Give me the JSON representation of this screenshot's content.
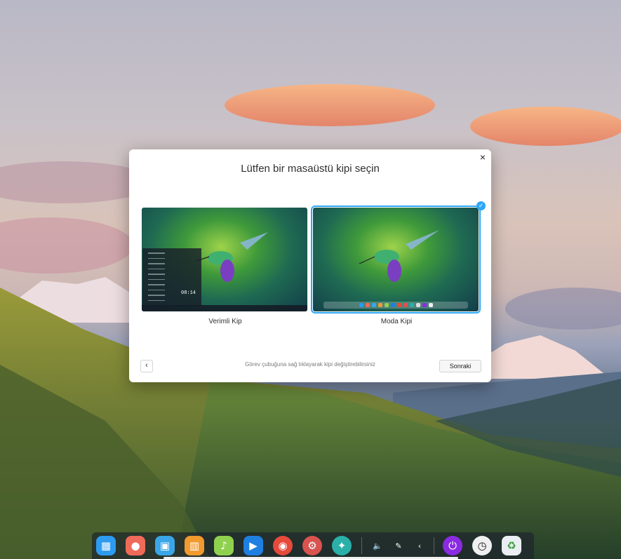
{
  "dialog": {
    "title": "Lütfen bir masaüstü kipi seçin",
    "close_glyph": "×",
    "options": [
      {
        "label": "Verimli Kip",
        "selected": false
      },
      {
        "label": "Moda Kipi",
        "selected": true
      }
    ],
    "efficient_preview_time": "08:14",
    "check_glyph": "✓",
    "back_glyph": "‹",
    "hint": "Görev çubuğuna sağ tıklayarak kipi değiştirebilirsiniz",
    "next_label": "Sonraki"
  },
  "dock": {
    "apps": [
      {
        "icon": "launcher-icon",
        "glyph": "▦",
        "color": "#2c9bf0"
      },
      {
        "icon": "screen-recorder-icon",
        "glyph": "●",
        "color": "#f06a5a"
      },
      {
        "icon": "file-manager-icon",
        "glyph": "▣",
        "color": "#3aa6e8"
      },
      {
        "icon": "app-store-icon",
        "glyph": "▥",
        "color": "#f29a2e"
      },
      {
        "icon": "music-icon",
        "glyph": "♪",
        "color": "#8fd14f"
      },
      {
        "icon": "video-player-icon",
        "glyph": "▶",
        "color": "#1f7fe0"
      },
      {
        "icon": "chrome-icon",
        "glyph": "◉",
        "color": "#e64a3b"
      },
      {
        "icon": "settings-icon",
        "glyph": "⚙",
        "color": "#d9534f"
      },
      {
        "icon": "deepin-icon",
        "glyph": "✦",
        "color": "#2ab0a8"
      }
    ],
    "tray": [
      {
        "icon": "volume-icon",
        "glyph": "🔈"
      },
      {
        "icon": "pen-icon",
        "glyph": "✎"
      },
      {
        "icon": "collapse-chevron-icon",
        "glyph": "‹"
      }
    ],
    "right": [
      {
        "icon": "power-icon",
        "glyph": "⏻",
        "color": "#8a2be2"
      },
      {
        "icon": "clock-icon",
        "glyph": "◷",
        "color": "#f0f0f0"
      },
      {
        "icon": "trash-icon",
        "glyph": "♻",
        "color": "#e9eef2"
      }
    ]
  }
}
